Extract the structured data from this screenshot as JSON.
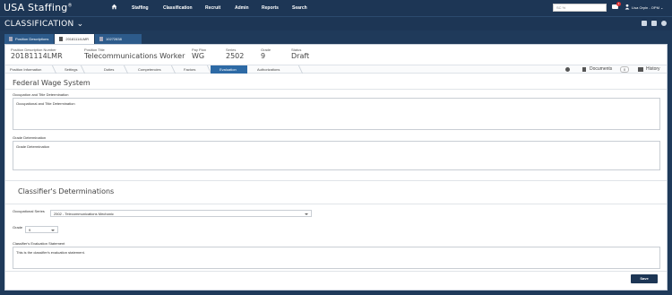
{
  "app": {
    "logo_text": "USA Staffing",
    "logo_mark": "®",
    "module_title": "CLASSIFICATION",
    "module_caret": "⌄"
  },
  "topnav": {
    "items": [
      "Staffing",
      "Classification",
      "Recruit",
      "Admin",
      "Reports",
      "Search"
    ],
    "search_placeholder": "SC %",
    "mail_badge": "1",
    "user_label": "Lisa Orpin - OPM ⌄"
  },
  "tabs": [
    {
      "label": "Position Descriptions"
    },
    {
      "label": "20181114LMR"
    },
    {
      "label": "10272838"
    }
  ],
  "position_header": {
    "pd_number_label": "Position Description Number",
    "pd_number": "20181114LMR",
    "title_label": "Position Title",
    "title": "Telecommunications Worker",
    "payplan_label": "Pay Plan",
    "payplan": "WG",
    "series_label": "Series",
    "series": "2502",
    "grade_label": "Grade",
    "grade": "9",
    "status_label": "Status",
    "status": "Draft"
  },
  "steps": [
    "Position Information",
    "Settings",
    "Duties",
    "Competencies",
    "Factors",
    "Evaluation",
    "Authorizations"
  ],
  "active_step": "Evaluation",
  "toolbar": {
    "documents_label": "Documents",
    "documents_count": "0",
    "history_label": "History"
  },
  "fws": {
    "section_title": "Federal Wage System",
    "occupation_label": "Occupation and Title Determination",
    "occupation_value": "Occupational and Title Determination",
    "grade_det_label": "Grade Determination",
    "grade_det_value": "Grade Determination"
  },
  "classifier": {
    "section_title": "Classifier's Determinations",
    "series_label": "Occupational Series",
    "series_value": "2502 - Telecommunications Mechanic",
    "grade_label": "Grade",
    "grade_value": "9",
    "statement_label": "Classifier's Evaluation Statement",
    "statement_value": "This is the classifier's evaluation statement."
  },
  "save_label": "Save",
  "colors": {
    "nav_bg": "#1d3655",
    "active_step": "#2d6aa5",
    "tab_bg": "#2d5b8b"
  }
}
